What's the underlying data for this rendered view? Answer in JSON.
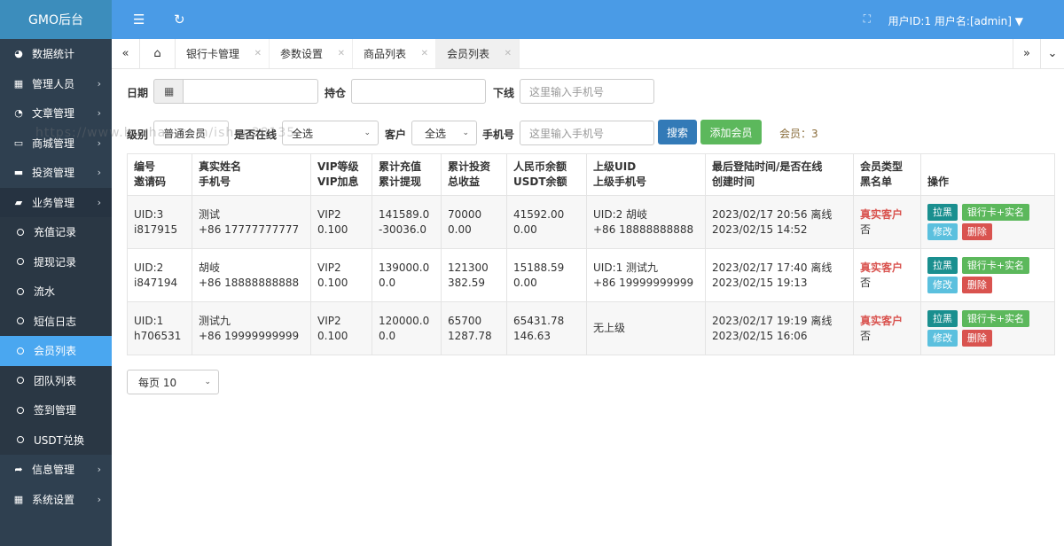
{
  "app": {
    "title": "GMO后台"
  },
  "sidebar": {
    "items": [
      {
        "label": "数据统计",
        "icon": "dashboard-icon",
        "glyph": "◕"
      },
      {
        "label": "管理人员",
        "icon": "grid-icon",
        "glyph": "▦"
      },
      {
        "label": "文章管理",
        "icon": "pie-chart-icon",
        "glyph": "◔"
      },
      {
        "label": "商城管理",
        "icon": "laptop-icon",
        "glyph": "▭"
      },
      {
        "label": "投资管理",
        "icon": "folder-icon",
        "glyph": "▬"
      },
      {
        "label": "业务管理",
        "icon": "book-icon",
        "glyph": "▰"
      },
      {
        "label": "充值记录"
      },
      {
        "label": "提现记录"
      },
      {
        "label": "流水"
      },
      {
        "label": "短信日志"
      },
      {
        "label": "会员列表"
      },
      {
        "label": "团队列表"
      },
      {
        "label": "签到管理"
      },
      {
        "label": "USDT兑换"
      },
      {
        "label": "信息管理",
        "icon": "share-icon",
        "glyph": "➦"
      },
      {
        "label": "系统设置",
        "icon": "calendar-icon",
        "glyph": "▦"
      }
    ]
  },
  "topbar": {
    "user": "用户ID:1 用户名:[admin]"
  },
  "tabs": [
    "银行卡管理",
    "参数设置",
    "商品列表",
    "会员列表"
  ],
  "filters": {
    "date_label": "日期",
    "hold_label": "持仓",
    "downline_label": "下线",
    "downline_placeholder": "这里输入手机号",
    "level_label": "级别",
    "level_value": "普通会员",
    "online_label": "是否在线",
    "online_value": "全选",
    "customer_label": "客户",
    "customer_value": "全选",
    "phone_label": "手机号",
    "phone_placeholder": "这里输入手机号",
    "search_btn": "搜索",
    "add_btn": "添加会员",
    "member_count": "会员：3"
  },
  "watermark": "https://www.huzhan.com/ishop38135",
  "table": {
    "headers": [
      [
        "编号",
        "邀请码"
      ],
      [
        "真实姓名",
        "手机号"
      ],
      [
        "VIP等级",
        "VIP加息"
      ],
      [
        "累计充值",
        "累计提现"
      ],
      [
        "累计投资",
        "总收益"
      ],
      [
        "人民币余额",
        "USDT余额"
      ],
      [
        "上级UID",
        "上级手机号"
      ],
      [
        "最后登陆时间/是否在线",
        "创建时间"
      ],
      [
        "会员类型",
        "黑名单"
      ],
      [
        "操作"
      ]
    ],
    "rows": [
      {
        "uid": "UID:3",
        "code": "i817915",
        "name": "测试",
        "phone": "+86 17777777777",
        "vip": "VIP2",
        "vip_rate": "0.100",
        "recharge": "141589.0",
        "withdraw": "-30036.0",
        "invest": "70000",
        "profit": "0.00",
        "rmb": "41592.00",
        "usdt": "0.00",
        "up1": "UID:2 胡岐",
        "up2": "+86 18888888888",
        "login": "2023/02/17 20:56 离线",
        "created": "2023/02/15 14:52",
        "type": "真实客户",
        "black": "否"
      },
      {
        "uid": "UID:2",
        "code": "i847194",
        "name": "胡岐",
        "phone": "+86 18888888888",
        "vip": "VIP2",
        "vip_rate": "0.100",
        "recharge": "139000.0",
        "withdraw": "0.0",
        "invest": "121300",
        "profit": "382.59",
        "rmb": "15188.59",
        "usdt": "0.00",
        "up1": "UID:1 测试九",
        "up2": "+86 19999999999",
        "login": "2023/02/17 17:40 离线",
        "created": "2023/02/15 19:13",
        "type": "真实客户",
        "black": "否"
      },
      {
        "uid": "UID:1",
        "code": "h706531",
        "name": "测试九",
        "phone": "+86 19999999999",
        "vip": "VIP2",
        "vip_rate": "0.100",
        "recharge": "120000.0",
        "withdraw": "0.0",
        "invest": "65700",
        "profit": "1287.78",
        "rmb": "65431.78",
        "usdt": "146.63",
        "up1": "无上级",
        "up2": "",
        "login": "2023/02/17 19:19 离线",
        "created": "2023/02/15 16:06",
        "type": "真实客户",
        "black": "否"
      }
    ],
    "actions": {
      "pull_black": "拉黑",
      "bank_realname": "银行卡+实名",
      "edit": "修改",
      "delete": "删除"
    }
  },
  "pager": {
    "label": "每页 10"
  },
  "colors": {
    "sidebar_bg": "#2f4050",
    "topbar_bg": "#4a9be6",
    "active_item": "#4aa7f0",
    "search_btn": "#337ab7",
    "add_btn": "#5cb85c"
  }
}
